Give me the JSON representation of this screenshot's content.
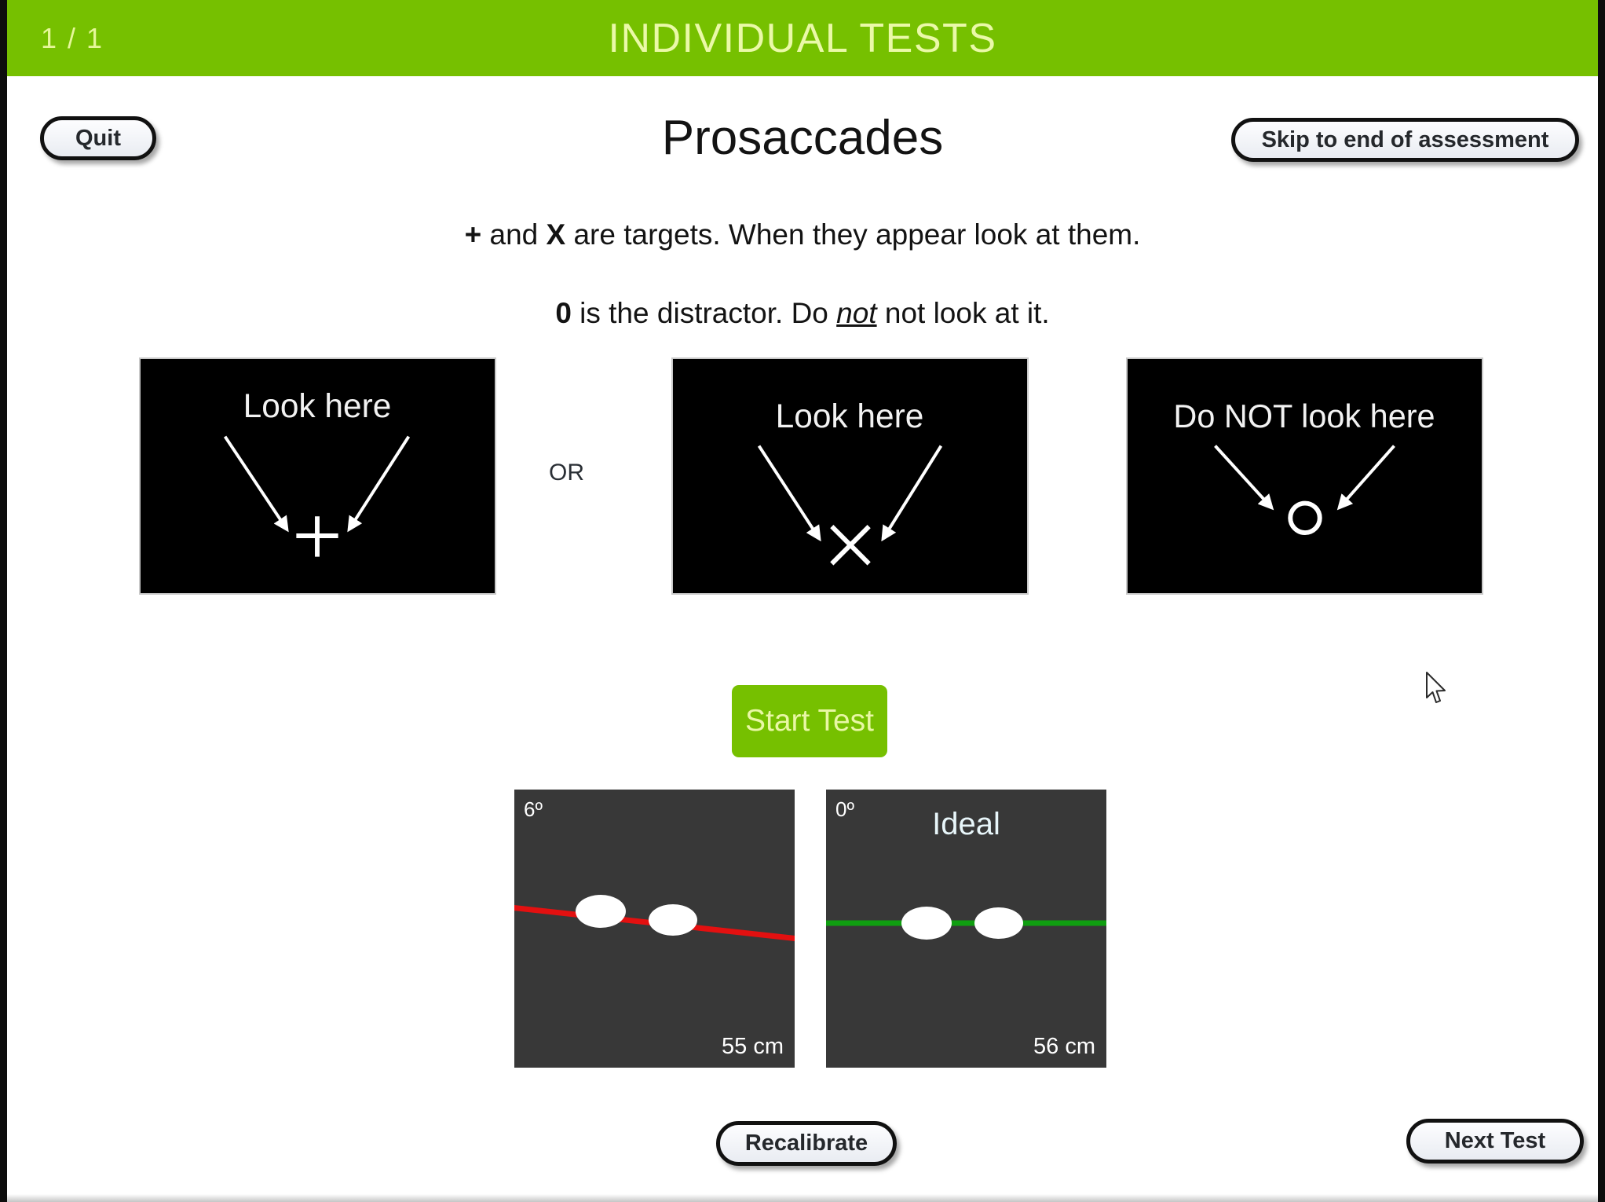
{
  "header": {
    "page_counter": "1 / 1",
    "title": "INDIVIDUAL TESTS",
    "background_color": "#76c000",
    "text_color": "#eaf9a8"
  },
  "toolbar": {
    "quit_label": "Quit",
    "skip_label": "Skip to end of assessment"
  },
  "test": {
    "title": "Prosaccades",
    "instruction_1": {
      "symbol_a": "+",
      "mid_1": " and ",
      "symbol_b": "X",
      "tail": " are targets. When they appear look at them."
    },
    "instruction_2": {
      "symbol": "0",
      "mid_1": " is the distractor. Do ",
      "emphasis": "not",
      "tail": " not look at it."
    },
    "or_label": "OR",
    "start_label": "Start Test"
  },
  "demos": [
    {
      "caption": "Look here",
      "target": "plus-target"
    },
    {
      "caption": "Look here",
      "target": "x-target"
    },
    {
      "caption": "Do NOT look here",
      "target": "circle-target"
    }
  ],
  "calibration": {
    "current": {
      "angle": "6º",
      "distance": "55 cm",
      "line_color": "#e31010",
      "panel_color": "#383838"
    },
    "ideal": {
      "angle": "0º",
      "label": "Ideal",
      "distance": "56 cm",
      "line_color": "#0f9e10",
      "panel_color": "#383838"
    }
  },
  "footer": {
    "recalibrate_label": "Recalibrate",
    "next_test_label": "Next Test"
  }
}
